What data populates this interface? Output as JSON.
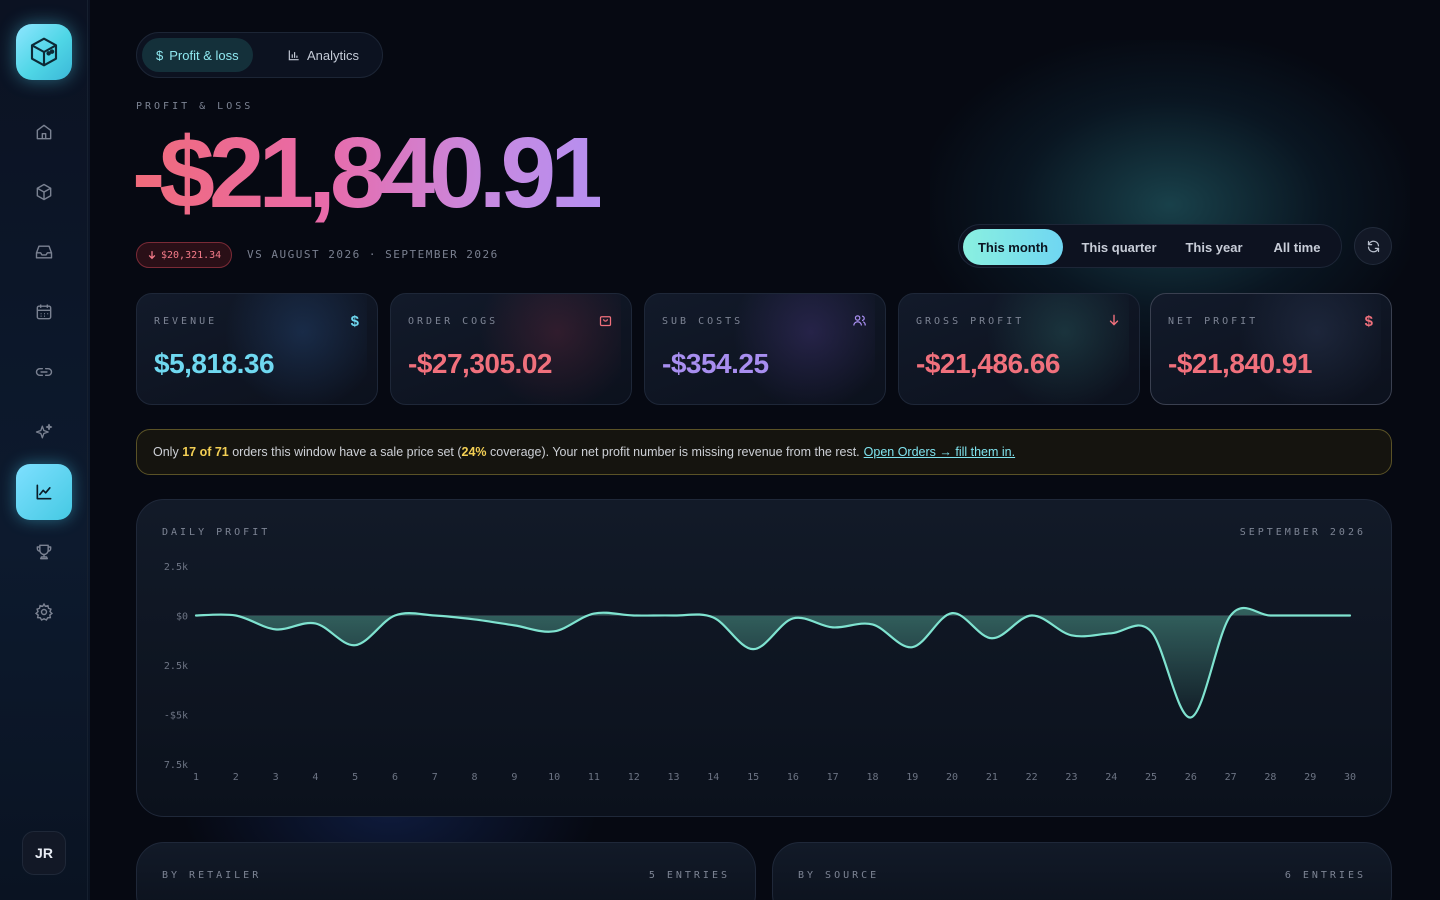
{
  "sidebar": {
    "logo_icon": "cube-logo-icon",
    "items": [
      {
        "name": "home",
        "icon": "home-icon",
        "active": false
      },
      {
        "name": "products",
        "icon": "box-icon",
        "active": false
      },
      {
        "name": "inbox",
        "icon": "inbox-icon",
        "active": false
      },
      {
        "name": "calendar",
        "icon": "calendar-icon",
        "active": false
      },
      {
        "name": "links",
        "icon": "link-icon",
        "active": false
      },
      {
        "name": "ai",
        "icon": "sparkles-icon",
        "active": false
      },
      {
        "name": "analytics",
        "icon": "chart-line-icon",
        "active": true
      },
      {
        "name": "achievements",
        "icon": "trophy-icon",
        "active": false
      },
      {
        "name": "settings",
        "icon": "gear-icon",
        "active": false
      }
    ],
    "avatar_initials": "JR"
  },
  "view_tabs": [
    {
      "label": "Profit & loss",
      "icon": "dollar-icon",
      "active": true
    },
    {
      "label": "Analytics",
      "icon": "bar-chart-icon",
      "active": false
    }
  ],
  "hero": {
    "label": "PROFIT & LOSS",
    "value": "-$21,840.91",
    "delta": "$20,321.34",
    "delta_direction": "down",
    "caption": "VS AUGUST 2026 · SEPTEMBER 2026"
  },
  "range": {
    "options": [
      "This month",
      "This quarter",
      "This year",
      "All time"
    ],
    "selected": "This month"
  },
  "kpis": [
    {
      "label": "REVENUE",
      "value": "$5,818.36",
      "icon": "dollar-icon",
      "color": "#6fd8f0"
    },
    {
      "label": "ORDER COGS",
      "value": "-$27,305.02",
      "icon": "bag-icon",
      "color": "#f0707c"
    },
    {
      "label": "SUB COSTS",
      "value": "-$354.25",
      "icon": "users-icon",
      "color": "#a88ef0"
    },
    {
      "label": "GROSS PROFIT",
      "value": "-$21,486.66",
      "icon": "arrow-down-icon",
      "color": "#f0707c"
    },
    {
      "label": "NET PROFIT",
      "value": "-$21,840.91",
      "icon": "dollar-icon",
      "color": "#f0707c"
    }
  ],
  "banner": {
    "prefix": "Only",
    "count": "17 of 71",
    "middle": "orders this window have a sale price set (",
    "coverage": "24%",
    "suffix": "coverage). Your net profit number is missing revenue from the rest.",
    "link": "Open Orders → fill them in."
  },
  "chart_data": {
    "type": "line",
    "title": "DAILY PROFIT",
    "period": "SEPTEMBER 2026",
    "x": [
      1,
      2,
      3,
      4,
      5,
      6,
      7,
      8,
      9,
      10,
      11,
      12,
      13,
      14,
      15,
      16,
      17,
      18,
      19,
      20,
      21,
      22,
      23,
      24,
      25,
      26,
      27,
      28,
      29,
      30
    ],
    "y": [
      0,
      0,
      -700,
      -400,
      -1500,
      0,
      0,
      -200,
      -500,
      -800,
      100,
      0,
      0,
      -100,
      -1700,
      -150,
      -600,
      -450,
      -1600,
      120,
      -1150,
      0,
      -1000,
      -900,
      -800,
      -5150,
      0,
      0,
      0,
      0
    ],
    "ytick_labels": [
      "2.5k",
      "$0",
      "2.5k",
      "-$5k",
      "7.5k"
    ],
    "ytick_values": [
      2500,
      0,
      -2500,
      -5000,
      -7500
    ],
    "ylim": [
      -7500,
      2500
    ],
    "line_color": "#7fe3d0"
  },
  "bottom_panels": [
    {
      "title": "BY RETAILER",
      "count": "5 ENTRIES"
    },
    {
      "title": "BY SOURCE",
      "count": "6 ENTRIES"
    }
  ]
}
